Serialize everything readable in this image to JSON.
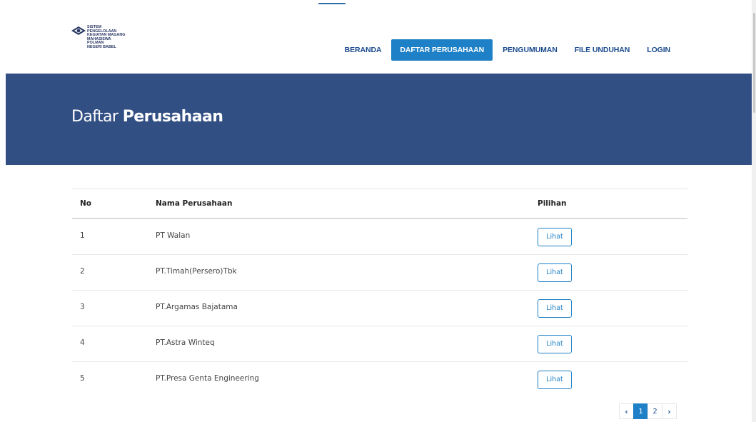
{
  "logo": {
    "lines": [
      "SISTEM",
      "PENGELOLAAN",
      "KEGIATAN MAGANG",
      "MAHASISWA",
      "POLMAN",
      "NEGERI BABEL"
    ]
  },
  "nav": {
    "items": [
      "BERANDA",
      "DAFTAR PERUSAHAAN",
      "PENGUMUMAN",
      "FILE UNDUHAN",
      "LOGIN"
    ],
    "active_index": 1
  },
  "hero": {
    "title_light": "Daftar",
    "title_bold": "Perusahaan"
  },
  "table": {
    "headers": {
      "no": "No",
      "name": "Nama Perusahaan",
      "action": "Pilihan"
    },
    "rows": [
      {
        "no": "1",
        "name": "PT Walan",
        "action": "Lihat"
      },
      {
        "no": "2",
        "name": "PT.Timah(Persero)Tbk",
        "action": "Lihat"
      },
      {
        "no": "3",
        "name": "PT.Argamas Bajatama",
        "action": "Lihat"
      },
      {
        "no": "4",
        "name": "PT.Astra Winteq",
        "action": "Lihat"
      },
      {
        "no": "5",
        "name": "PT.Presa Genta Engineering",
        "action": "Lihat"
      }
    ]
  },
  "pagination": {
    "prev": "‹",
    "pages": [
      "1",
      "2"
    ],
    "current": "1",
    "next": "›"
  },
  "colors": {
    "hero_bg": "#324f84",
    "accent": "#1e80c6",
    "nav_text": "#1b4a8e"
  }
}
